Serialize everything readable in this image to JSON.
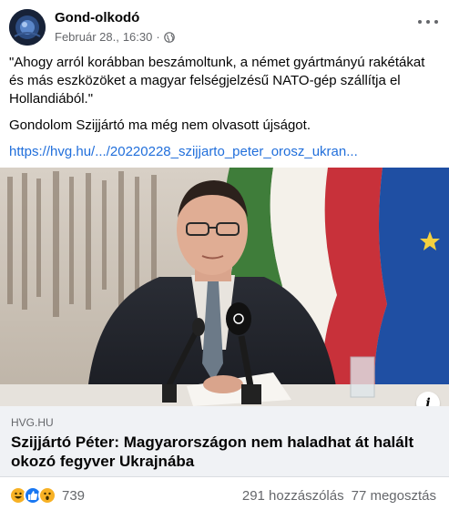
{
  "post": {
    "author": "Gond-olkodó",
    "timestamp": "Február 28.,",
    "time": "16:30",
    "separator": "·",
    "privacy_icon": "globe-icon",
    "more_icon": "more-options-icon"
  },
  "body": {
    "quote": "\"Ahogy arról korábban beszámoltunk, a német gyártmányú rakétákat és más eszközöket a magyar felségjelzésű NATO-gép szállítja el Hollandiából.\"",
    "comment": "Gondolom Szijjártó ma még nem olvasott újságot.",
    "link": "https://hvg.hu/.../20220228_szijjarto_peter_orosz_ukran..."
  },
  "preview": {
    "domain": "HVG.HU",
    "headline": "Szijjártó Péter: Magyarországon nem haladhat át halált okozó fegyver Ukrajnába",
    "info_label": "i"
  },
  "engagement": {
    "reactions": [
      "haha",
      "like",
      "wow"
    ],
    "reaction_count": "739",
    "comments": "291 hozzászólás",
    "shares": "77 megosztás"
  },
  "colors": {
    "link": "#216fdb",
    "secondary_text": "#65676b",
    "like_blue": "#1877f2",
    "reaction_yellow": "#f7b125"
  }
}
